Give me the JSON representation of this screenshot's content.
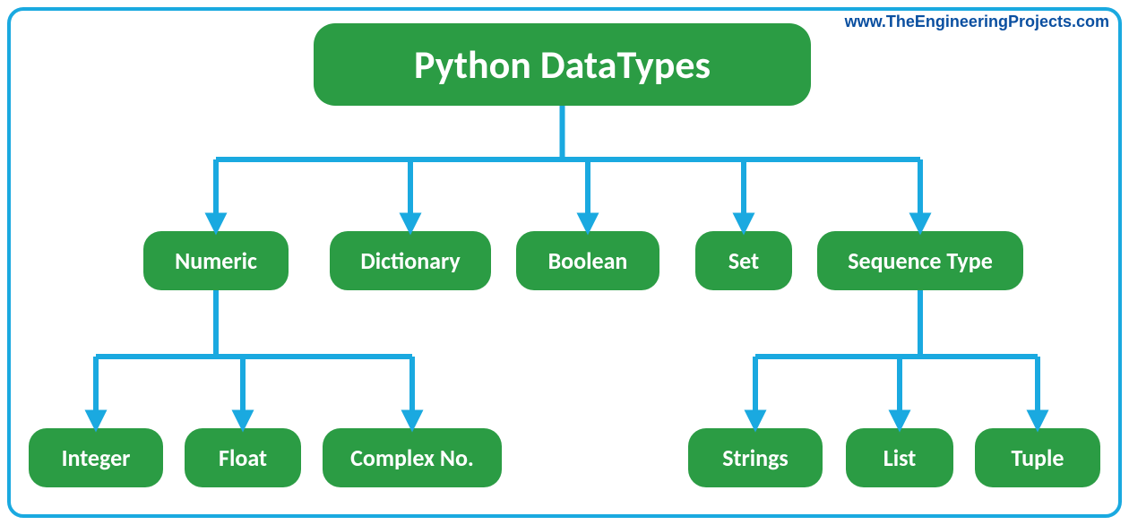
{
  "watermark": "www.TheEngineeringProjects.com",
  "root": {
    "label": "Python DataTypes"
  },
  "level2": {
    "numeric": {
      "label": "Numeric"
    },
    "dictionary": {
      "label": "Dictionary"
    },
    "boolean": {
      "label": "Boolean"
    },
    "set": {
      "label": "Set"
    },
    "sequence": {
      "label": "Sequence Type"
    }
  },
  "numeric_children": {
    "integer": {
      "label": "Integer"
    },
    "float": {
      "label": "Float"
    },
    "complex": {
      "label": "Complex No."
    }
  },
  "sequence_children": {
    "strings": {
      "label": "Strings"
    },
    "list": {
      "label": "List"
    },
    "tuple": {
      "label": "Tuple"
    }
  },
  "colors": {
    "node_bg": "#2b9c44",
    "connector": "#1aa9e0",
    "watermark_text": "#0a4fa0"
  }
}
